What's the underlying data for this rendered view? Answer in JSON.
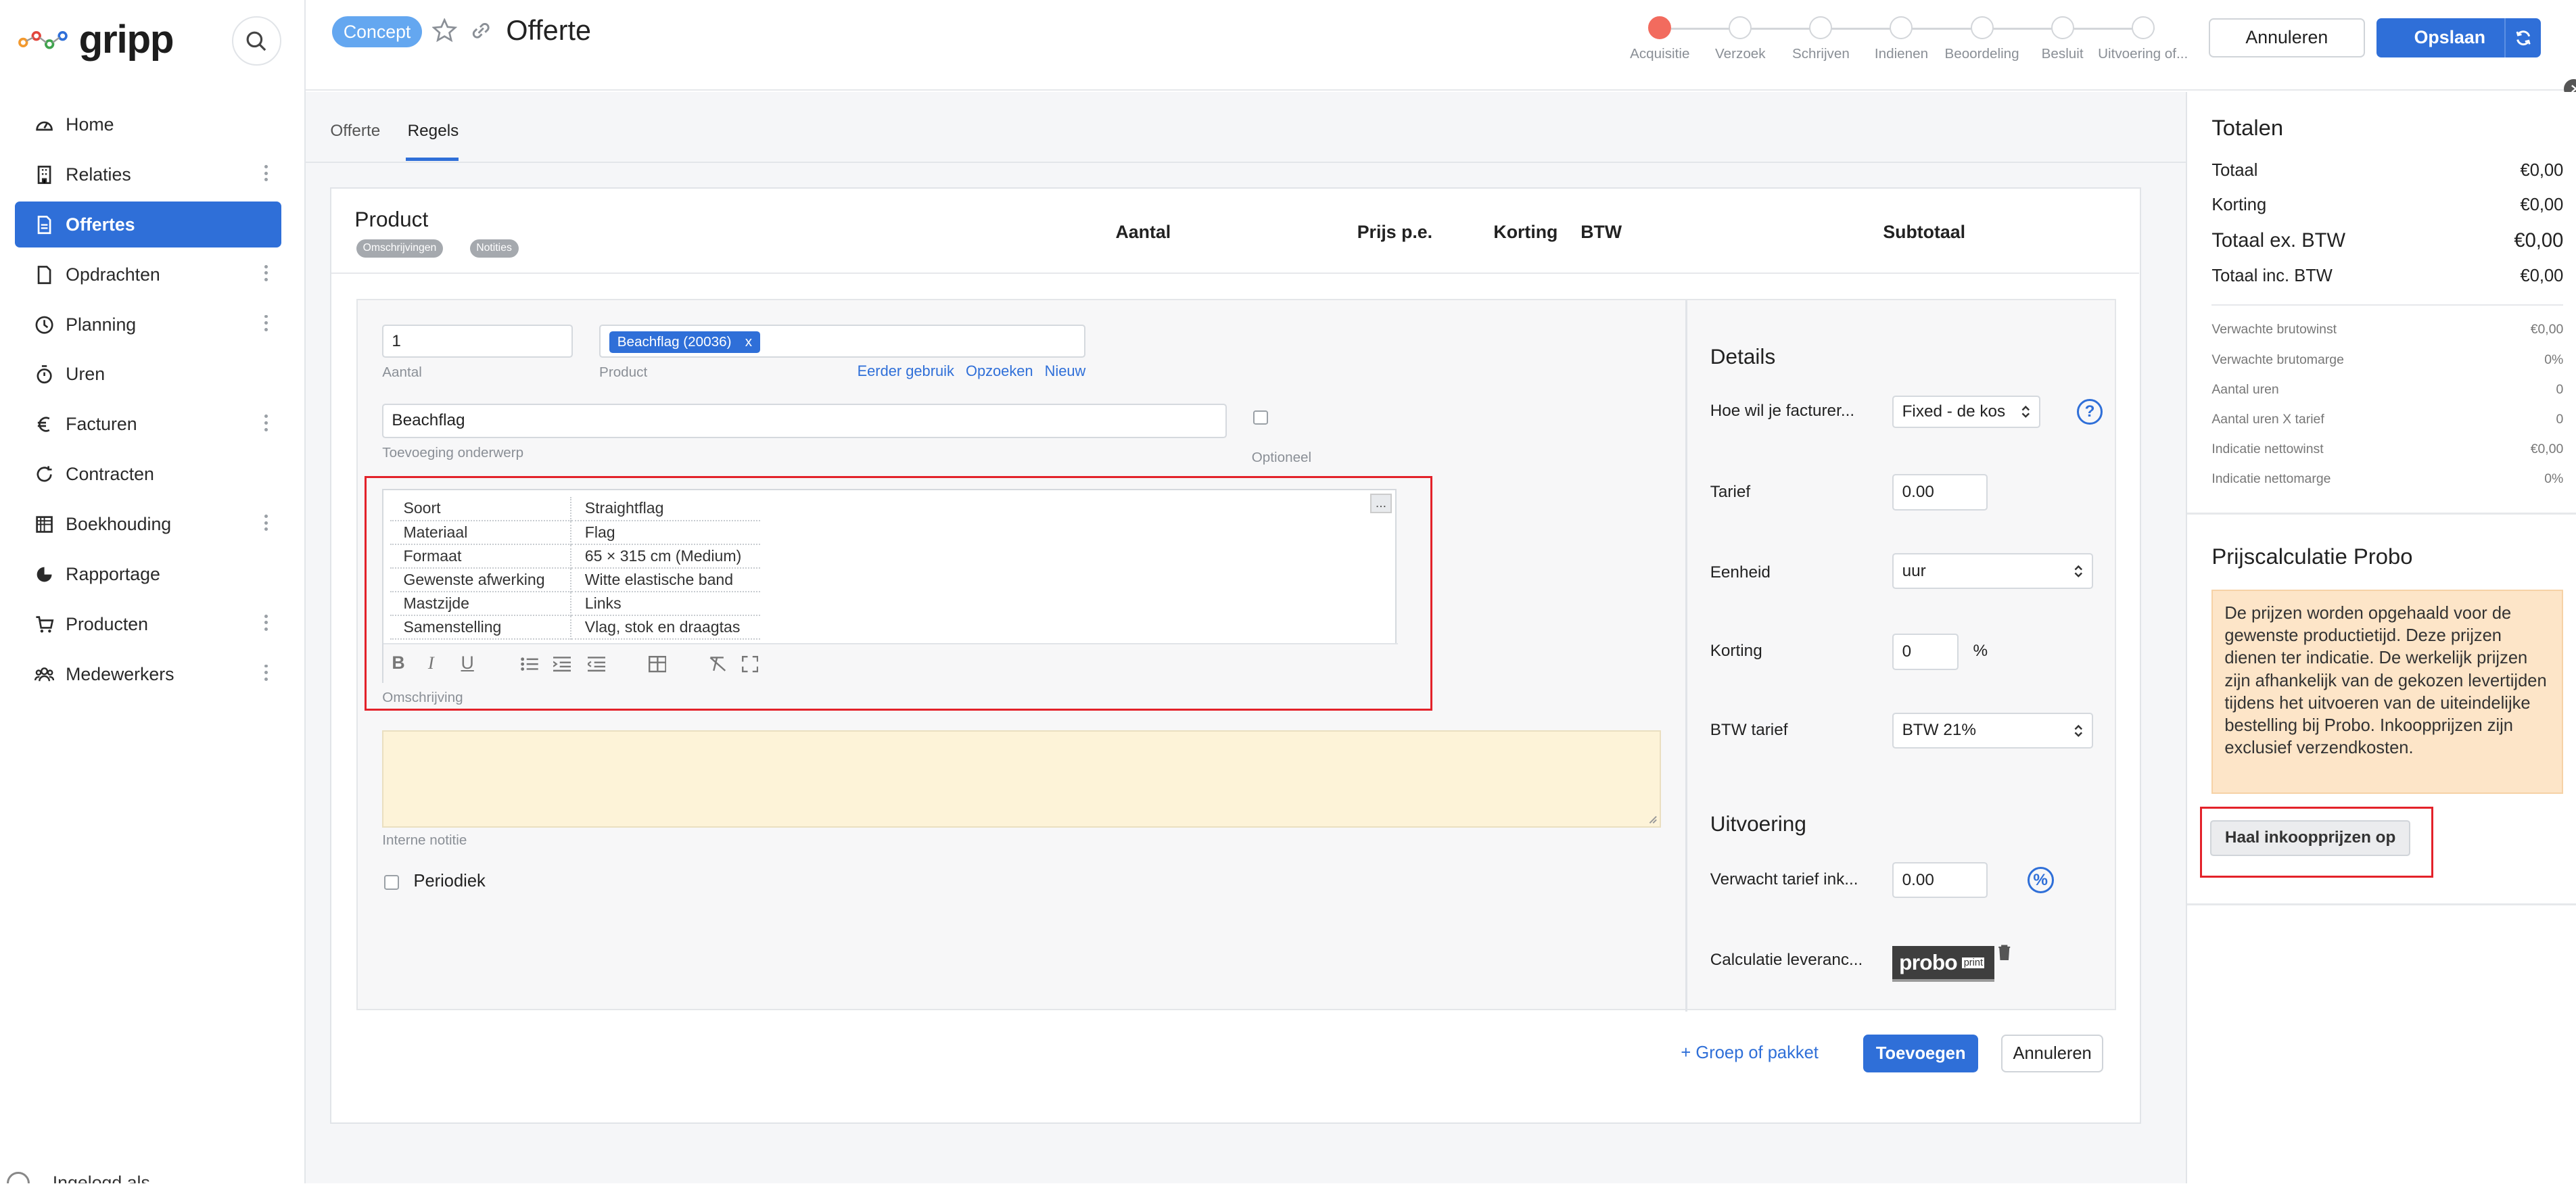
{
  "app": {
    "name": "gripp"
  },
  "sidebar": {
    "items": [
      {
        "label": "Home",
        "icon": "dashboard-icon",
        "menu": false
      },
      {
        "label": "Relaties",
        "icon": "building-icon",
        "menu": true
      },
      {
        "label": "Offertes",
        "icon": "document-icon",
        "menu": false,
        "active": true
      },
      {
        "label": "Opdrachten",
        "icon": "file-icon",
        "menu": true
      },
      {
        "label": "Planning",
        "icon": "clock-icon",
        "menu": true
      },
      {
        "label": "Uren",
        "icon": "stopwatch-icon",
        "menu": false
      },
      {
        "label": "Facturen",
        "icon": "euro-icon",
        "menu": true
      },
      {
        "label": "Contracten",
        "icon": "refresh-icon",
        "menu": false
      },
      {
        "label": "Boekhouding",
        "icon": "grid-icon",
        "menu": true
      },
      {
        "label": "Rapportage",
        "icon": "pie-chart-icon",
        "menu": false
      },
      {
        "label": "Producten",
        "icon": "cart-icon",
        "menu": true
      },
      {
        "label": "Medewerkers",
        "icon": "users-icon",
        "menu": true
      }
    ],
    "user_label": "Ingelogd als"
  },
  "header": {
    "status_badge": "Concept",
    "title": "Offerte",
    "steps": [
      "Acquisitie",
      "Verzoek",
      "Schrijven",
      "Indienen",
      "Beoordeling",
      "Besluit",
      "Uitvoering of..."
    ],
    "cancel_label": "Annuleren",
    "save_label": "Opslaan"
  },
  "tabs": [
    "Offerte",
    "Regels"
  ],
  "active_tab": "Regels",
  "product_table": {
    "product_header": "Product",
    "pills": [
      "Omschrijvingen",
      "Notities"
    ],
    "columns": [
      "Aantal",
      "Prijs p.e.",
      "Korting",
      "BTW",
      "Subtotaal"
    ]
  },
  "line_form": {
    "aantal_value": "1",
    "aantal_caption": "Aantal",
    "product_chip": "Beachflag (20036)",
    "chip_remove": "x",
    "product_caption": "Product",
    "links": [
      "Eerder gebruik",
      "Opzoeken",
      "Nieuw"
    ],
    "onderwerp_value": "Beachflag",
    "onderwerp_caption": "Toevoeging onderwerp",
    "optioneel_label": "Optioneel",
    "description_rows": [
      {
        "key": "Soort",
        "value": "Straightflag"
      },
      {
        "key": "Materiaal",
        "value": "Flag"
      },
      {
        "key": "Formaat",
        "value": "65 × 315 cm (Medium)"
      },
      {
        "key": "Gewenste afwerking",
        "value": "Witte elastische band"
      },
      {
        "key": "Mastzijde",
        "value": "Links"
      },
      {
        "key": "Samenstelling",
        "value": "Vlag, stok en draagtas"
      }
    ],
    "editor_more": "...",
    "toolbar": {
      "bold": "B",
      "italic": "I",
      "underline": "U"
    },
    "omschrijving_caption": "Omschrijving",
    "notitie_caption": "Interne notitie",
    "periodiek_label": "Periodiek"
  },
  "details": {
    "title": "Details",
    "facturering_label": "Hoe wil je facturer...",
    "facturering_value": "Fixed - de kos",
    "help": "?",
    "tarief_label": "Tarief",
    "tarief_value": "0.00",
    "eenheid_label": "Eenheid",
    "eenheid_value": "uur",
    "korting_label": "Korting",
    "korting_value": "0",
    "korting_unit": "%",
    "btw_label": "BTW tarief",
    "btw_value": "BTW 21%",
    "uitvoering_title": "Uitvoering",
    "verwacht_label": "Verwacht tarief ink...",
    "verwacht_value": "0.00",
    "percent_symbol": "%",
    "calc_label": "Calculatie leveranc...",
    "probo_logo_text": "probo",
    "probo_logo_sub": "print"
  },
  "footer_actions": {
    "group_label": "+ Groep of pakket",
    "add_label": "Toevoegen",
    "cancel_label": "Annuleren"
  },
  "totals": {
    "title": "Totalen",
    "rows": [
      {
        "label": "Totaal",
        "value": "€0,00"
      },
      {
        "label": "Korting",
        "value": "€0,00"
      },
      {
        "label": "Totaal ex. BTW",
        "value": "€0,00"
      },
      {
        "label": "Totaal inc. BTW",
        "value": "€0,00"
      }
    ],
    "small_rows": [
      {
        "label": "Verwachte brutowinst",
        "value": "€0,00"
      },
      {
        "label": "Verwachte brutomarge",
        "value": "0%"
      },
      {
        "label": "Aantal uren",
        "value": "0"
      },
      {
        "label": "Aantal uren X tarief",
        "value": "0"
      },
      {
        "label": "Indicatie nettowinst",
        "value": "€0,00"
      },
      {
        "label": "Indicatie nettomarge",
        "value": "0%"
      }
    ]
  },
  "probo": {
    "title": "Prijscalculatie Probo",
    "info": "De prijzen worden opgehaald voor de gewenste productietijd. Deze prijzen dienen ter indicatie. De werkelijk prijzen zijn afhankelijk van de gekozen levertijden tijdens het uitvoeren van de uiteindelijke bestelling bij Probo. Inkoopprijzen zijn exclusief verzendkosten.",
    "button_label": "Haal inkoopprijzen op"
  },
  "colors": {
    "accent": "#2f6fd8",
    "highlight_box": "#e3222a",
    "step_done": "#f26b5e",
    "note_bg": "#fdf3d8",
    "info_bg": "#fde5c8"
  }
}
